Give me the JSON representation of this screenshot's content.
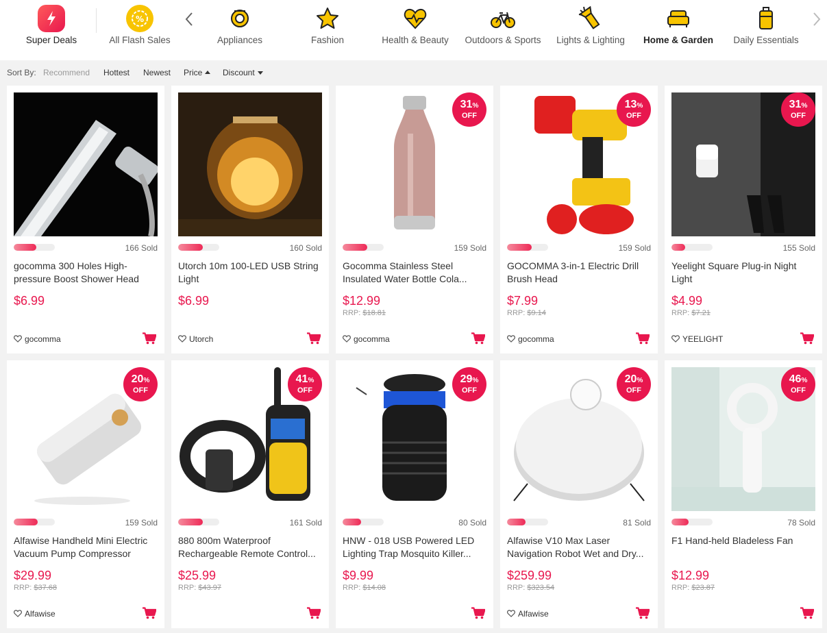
{
  "nav": {
    "super_deals": "Super Deals",
    "all_flash_sales": "All Flash Sales",
    "categories": [
      "Appliances",
      "Fashion",
      "Health & Beauty",
      "Outdoors & Sports",
      "Lights & Lighting",
      "Home & Garden",
      "Daily Essentials"
    ],
    "active_category": "Home & Garden"
  },
  "sort": {
    "label": "Sort By:",
    "options": [
      "Recommend",
      "Hottest",
      "Newest",
      "Price",
      "Discount"
    ]
  },
  "colors": {
    "accent": "#e8174e",
    "yellow": "#f8c400"
  },
  "products": [
    {
      "title": "gocomma 300 Holes High-pressure Boost Shower Head",
      "price": "$6.99",
      "rrp_label": "",
      "rrp": "",
      "sold": "166 Sold",
      "sold_fraction": 0.55,
      "store": "gocomma",
      "discount": "",
      "off": "",
      "image": "shower-head-image"
    },
    {
      "title": "Utorch 10m 100-LED USB String Light",
      "price": "$6.99",
      "rrp_label": "",
      "rrp": "",
      "sold": "160 Sold",
      "sold_fraction": 0.6,
      "store": "Utorch",
      "discount": "",
      "off": "",
      "image": "string-light-jar-image"
    },
    {
      "title": "Gocomma Stainless Steel Insulated Water Bottle Cola...",
      "price": "$12.99",
      "rrp_label": "RRP:",
      "rrp": "$18.81",
      "sold": "159 Sold",
      "sold_fraction": 0.6,
      "store": "gocomma",
      "discount": "31",
      "off": "OFF",
      "image": "water-bottle-image"
    },
    {
      "title": "GOCOMMA 3-in-1 Electric Drill Brush Head",
      "price": "$7.99",
      "rrp_label": "RRP:",
      "rrp": "$9.14",
      "sold": "159 Sold",
      "sold_fraction": 0.6,
      "store": "gocomma",
      "discount": "13",
      "off": "OFF",
      "image": "drill-brush-image"
    },
    {
      "title": "Yeelight Square Plug-in Night Light",
      "price": "$4.99",
      "rrp_label": "RRP:",
      "rrp": "$7.21",
      "sold": "155 Sold",
      "sold_fraction": 0.33,
      "store": "YEELIGHT",
      "discount": "31",
      "off": "OFF",
      "image": "night-light-image"
    },
    {
      "title": "Alfawise Handheld Mini Electric Vacuum Pump Compressor",
      "price": "$29.99",
      "rrp_label": "RRP:",
      "rrp": "$37.68",
      "sold": "159 Sold",
      "sold_fraction": 0.58,
      "store": "Alfawise",
      "discount": "20",
      "off": "OFF",
      "image": "vacuum-pump-image"
    },
    {
      "title": "880 800m Waterproof Rechargeable Remote Control...",
      "price": "$25.99",
      "rrp_label": "RRP:",
      "rrp": "$43.97",
      "sold": "161 Sold",
      "sold_fraction": 0.6,
      "store": "",
      "discount": "41",
      "off": "OFF",
      "image": "dog-collar-remote-image"
    },
    {
      "title": "HNW - 018 USB Powered LED Lighting Trap Mosquito Killer...",
      "price": "$9.99",
      "rrp_label": "RRP:",
      "rrp": "$14.08",
      "sold": "80 Sold",
      "sold_fraction": 0.45,
      "store": "",
      "discount": "29",
      "off": "OFF",
      "image": "mosquito-trap-image"
    },
    {
      "title": "Alfawise V10 Max Laser Navigation Robot Wet and Dry...",
      "price": "$259.99",
      "rrp_label": "RRP:",
      "rrp": "$323.54",
      "sold": "81 Sold",
      "sold_fraction": 0.45,
      "store": "Alfawise",
      "discount": "20",
      "off": "OFF",
      "image": "robot-vacuum-image"
    },
    {
      "title": "F1 Hand-held Bladeless Fan",
      "price": "$12.99",
      "rrp_label": "RRP:",
      "rrp": "$23.87",
      "sold": "78 Sold",
      "sold_fraction": 0.42,
      "store": "",
      "discount": "46",
      "off": "OFF",
      "image": "bladeless-fan-image"
    }
  ]
}
